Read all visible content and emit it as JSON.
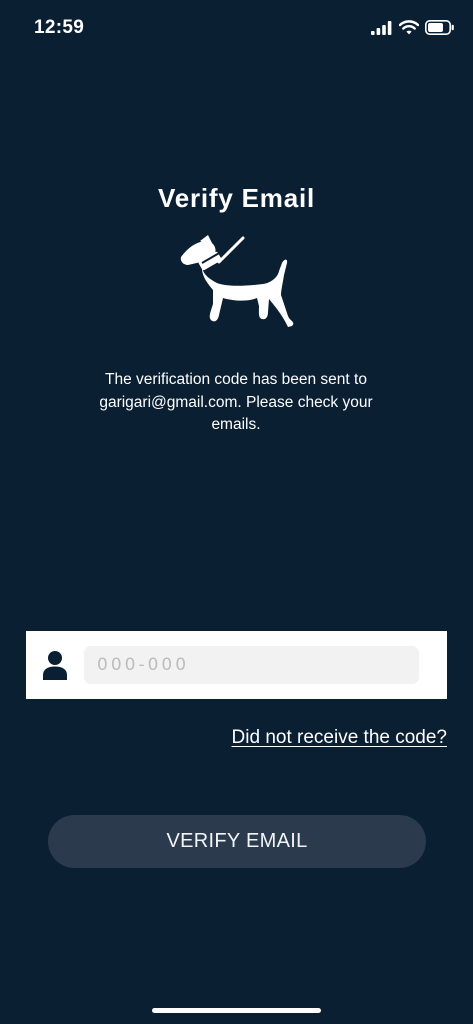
{
  "status_bar": {
    "time": "12:59",
    "icons": [
      "signal-icon",
      "wifi-icon",
      "battery-icon"
    ]
  },
  "page": {
    "title": "Verify Email",
    "illustration": "dog-icon",
    "message": "The verification code has been sent to garigari@gmail.com. Please check your emails."
  },
  "code_field": {
    "icon": "person-icon",
    "value": "",
    "placeholder": "000-000"
  },
  "resend_link": {
    "label": "Did not receive the code?"
  },
  "verify_button": {
    "label": "VERIFY EMAIL"
  },
  "colors": {
    "background": "#0b1f33",
    "button": "#2b3a4c",
    "input_fill": "#f2f2f2",
    "panel": "#ffffff"
  }
}
